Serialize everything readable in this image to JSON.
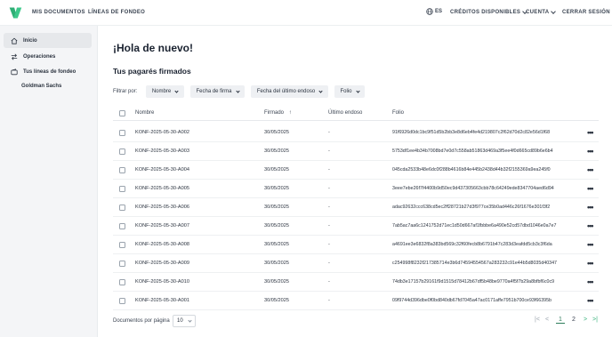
{
  "topbar": {
    "nav": [
      "MIS DOCUMENTOS",
      "LÍNEAS DE FONDEO"
    ],
    "language": "ES",
    "credits": "CRÉDITOS DISPONIBLES",
    "account": "CUENTA",
    "logout": "CERRAR SESIÓN",
    "brand_color": "#3cc88a"
  },
  "sidebar": {
    "items": [
      {
        "label": "Inicio",
        "icon": "home-icon"
      },
      {
        "label": "Operaciones",
        "icon": "transfer-icon"
      },
      {
        "label": "Tus líneas de fondeo",
        "icon": "wallet-icon"
      }
    ],
    "sub_items": [
      "Goldman Sachs"
    ]
  },
  "main": {
    "greeting": "¡Hola de nuevo!",
    "section_title": "Tus pagarés firmados",
    "filter_label": "Filtrar por:",
    "filters": [
      "Nombre",
      "Fecha de firma",
      "Fecha del último endoso",
      "Folio"
    ],
    "columns": [
      "Nombre",
      "Firmado",
      "Último endoso",
      "Folio"
    ],
    "sort_indicator": "↑",
    "rows": [
      {
        "name": "KONF-2025-05-30-A002",
        "signed": "30/05/2025",
        "endorsement": "-",
        "folio": "91f6926d0dc1bc9f51d5b2bb3e8d6eb4fe4d219807c2f62d70d2c82e56d1f68"
      },
      {
        "name": "KONF-2025-05-30-A003",
        "signed": "30/05/2025",
        "endorsement": "-",
        "folio": "5753df1ee4b34b7008bd7e0d7c558ab51863d469a3f5ee4f0d665cd89b6e6b4"
      },
      {
        "name": "KONF-2025-05-30-A004",
        "signed": "30/05/2025",
        "endorsement": "-",
        "folio": "045cda2533b48e6dc0f288b4616b84e445b2438d44b32f2155369a9ea245f0"
      },
      {
        "name": "KONF-2025-05-30-A005",
        "signed": "30/05/2025",
        "endorsement": "-",
        "folio": "3eee7ebe26f7f4400b9d50ec9d437305663cbb78c64249ede8347704aed6d94"
      },
      {
        "name": "KONF-2025-05-30-A006",
        "signed": "30/05/2025",
        "endorsement": "-",
        "folio": "adac92632ccc638cd5ec2ff28721b27d3f977ce35b0ad446c26f1676e301f3f2"
      },
      {
        "name": "KONF-2025-05-30-A007",
        "signed": "30/05/2025",
        "endorsement": "-",
        "folio": "7ab5ac7aa6c1241752d71ec1d50d667af1fbbbe6a490e52cd57dbd1046e0a7e7"
      },
      {
        "name": "KONF-2025-05-30-A008",
        "signed": "30/05/2025",
        "endorsement": "-",
        "folio": "a4691ee3e6832f8a383bd569c32f60fecb8b6791b47c283d3eafdd5cb3c3f6da"
      },
      {
        "name": "KONF-2025-05-30-A009",
        "signed": "30/05/2025",
        "endorsement": "-",
        "folio": "c254998f8232f217385714e3b6d74594554567a283232c91e44b5d8035d40347"
      },
      {
        "name": "KONF-2025-05-30-A010",
        "signed": "30/05/2025",
        "endorsement": "-",
        "folio": "74db3e17157b29161f9d1515d78412b67df5b48be9770a4f5f7b29a8bfbf6c0c9"
      },
      {
        "name": "KONF-2025-05-30-A001",
        "signed": "30/05/2025",
        "endorsement": "-",
        "folio": "09f9744d396dbe0f0bd840db67fd7045a47ac0171affe7951b700ce93f66395b"
      }
    ],
    "footer": {
      "page_size_label": "Documentos por página",
      "page_size": "10",
      "pages": [
        "1",
        "2"
      ],
      "current_page": "1",
      "first": "|<",
      "prev": "<",
      "next": ">",
      "last": ">|"
    }
  }
}
